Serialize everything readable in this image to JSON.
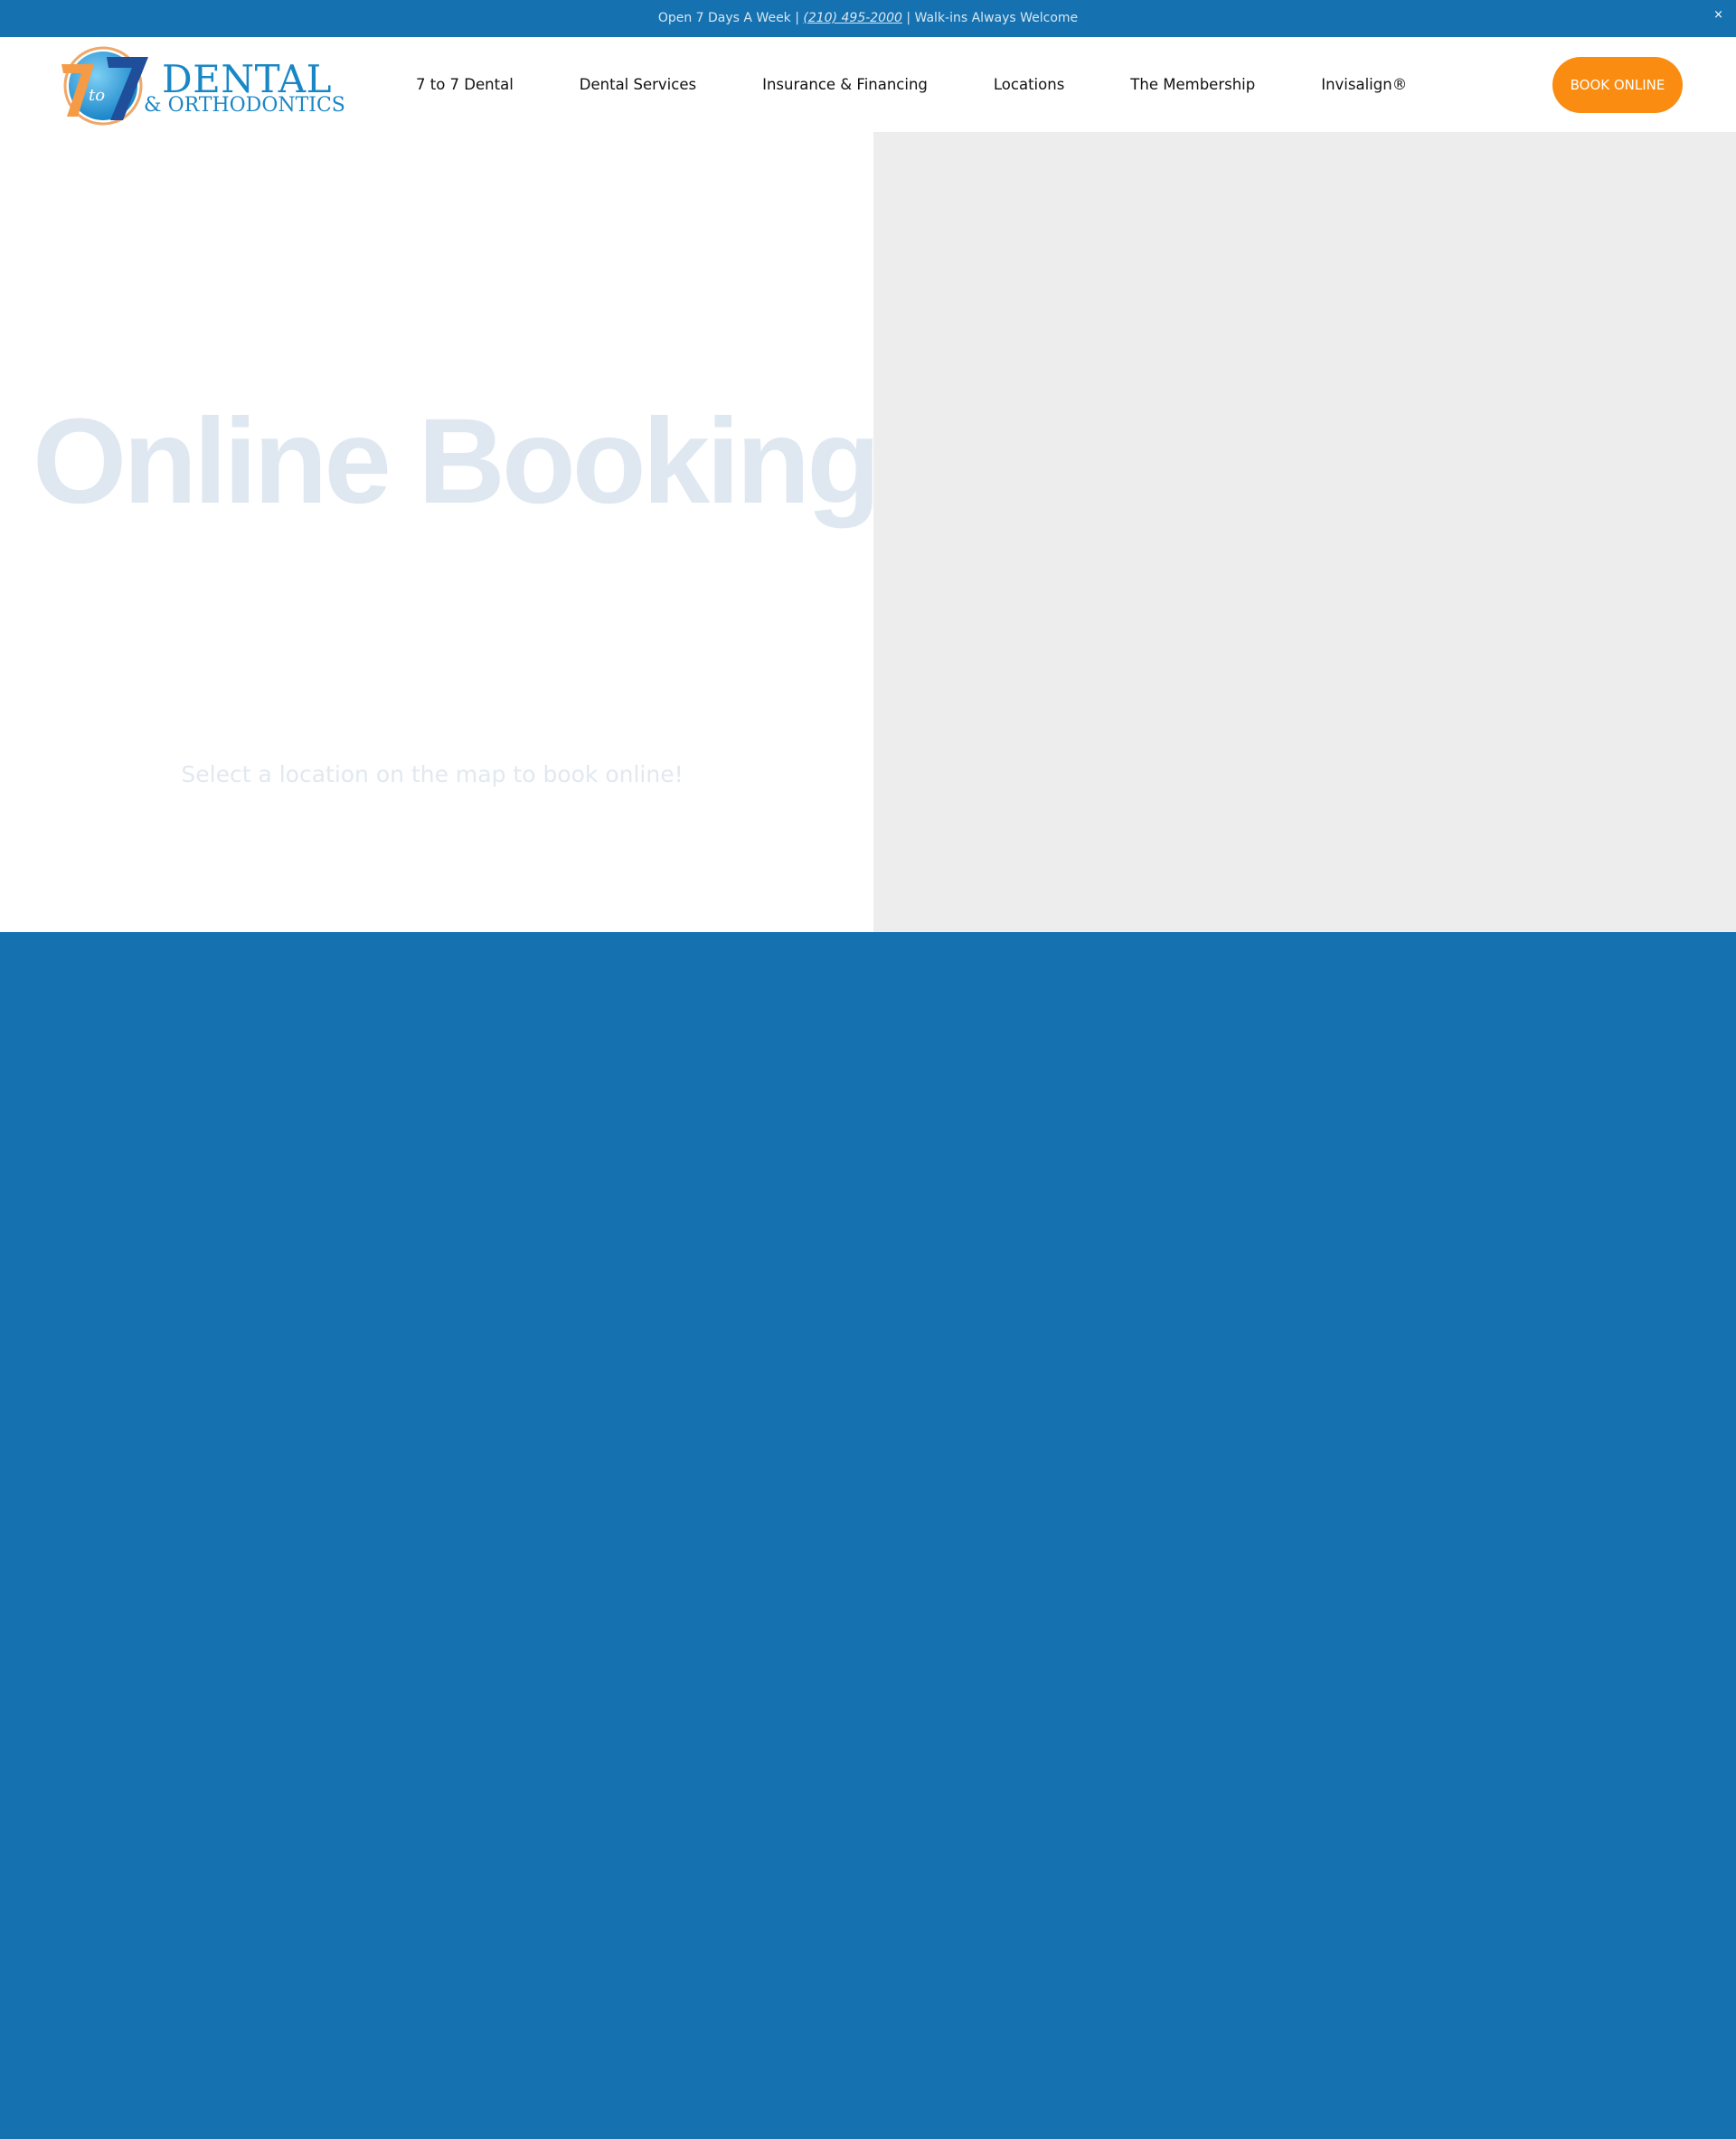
{
  "topbar": {
    "text_before": "Open 7 Days A Week | ",
    "phone": "(210) 495-2000",
    "text_after": " | Walk-ins Always Welcome",
    "close_label": "×"
  },
  "logo": {
    "line1": "DENTAL",
    "line2": "& ORTHODONTICS",
    "mark_icon": "7-to-7-logo-icon"
  },
  "nav": {
    "items": [
      "7 to 7 Dental",
      "Dental Services",
      "Insurance & Financing",
      "Locations",
      "The Membership",
      "Invisalign®"
    ],
    "cta_label": "BOOK ONLINE"
  },
  "hero": {
    "title": "Online Booking",
    "subtitle": "Select a location on the map to book online!"
  },
  "colors": {
    "brand_blue": "#1571b0",
    "cta_orange": "#f98c11",
    "logo_blue": "#1987c6",
    "map_gray": "#ededed"
  }
}
